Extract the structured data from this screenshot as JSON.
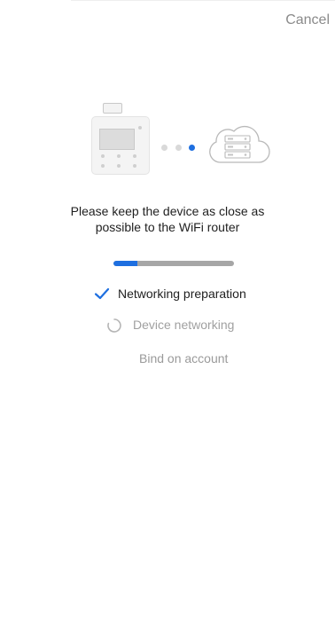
{
  "header": {
    "cancel_label": "Cancel"
  },
  "illustration": {
    "device_icon": "thermostat-controller-icon",
    "cloud_icon": "cloud-server-icon",
    "connection_dots": 3,
    "active_dot": 3
  },
  "message": {
    "line1": "Please keep the device as close as",
    "line2": "possible to the WiFi router"
  },
  "progress": {
    "fraction": 0.2
  },
  "steps": [
    {
      "label": "Networking preparation",
      "status": "done",
      "icon": "check-icon"
    },
    {
      "label": "Device networking",
      "status": "in-progress",
      "icon": "loading-spinner-icon"
    },
    {
      "label": "Bind on account",
      "status": "pending"
    }
  ],
  "colors": {
    "accent": "#1e6fe0",
    "muted_text": "#a0a0a0",
    "cancel_text": "#8a8a8a",
    "progress_track": "#a6a6a6"
  }
}
